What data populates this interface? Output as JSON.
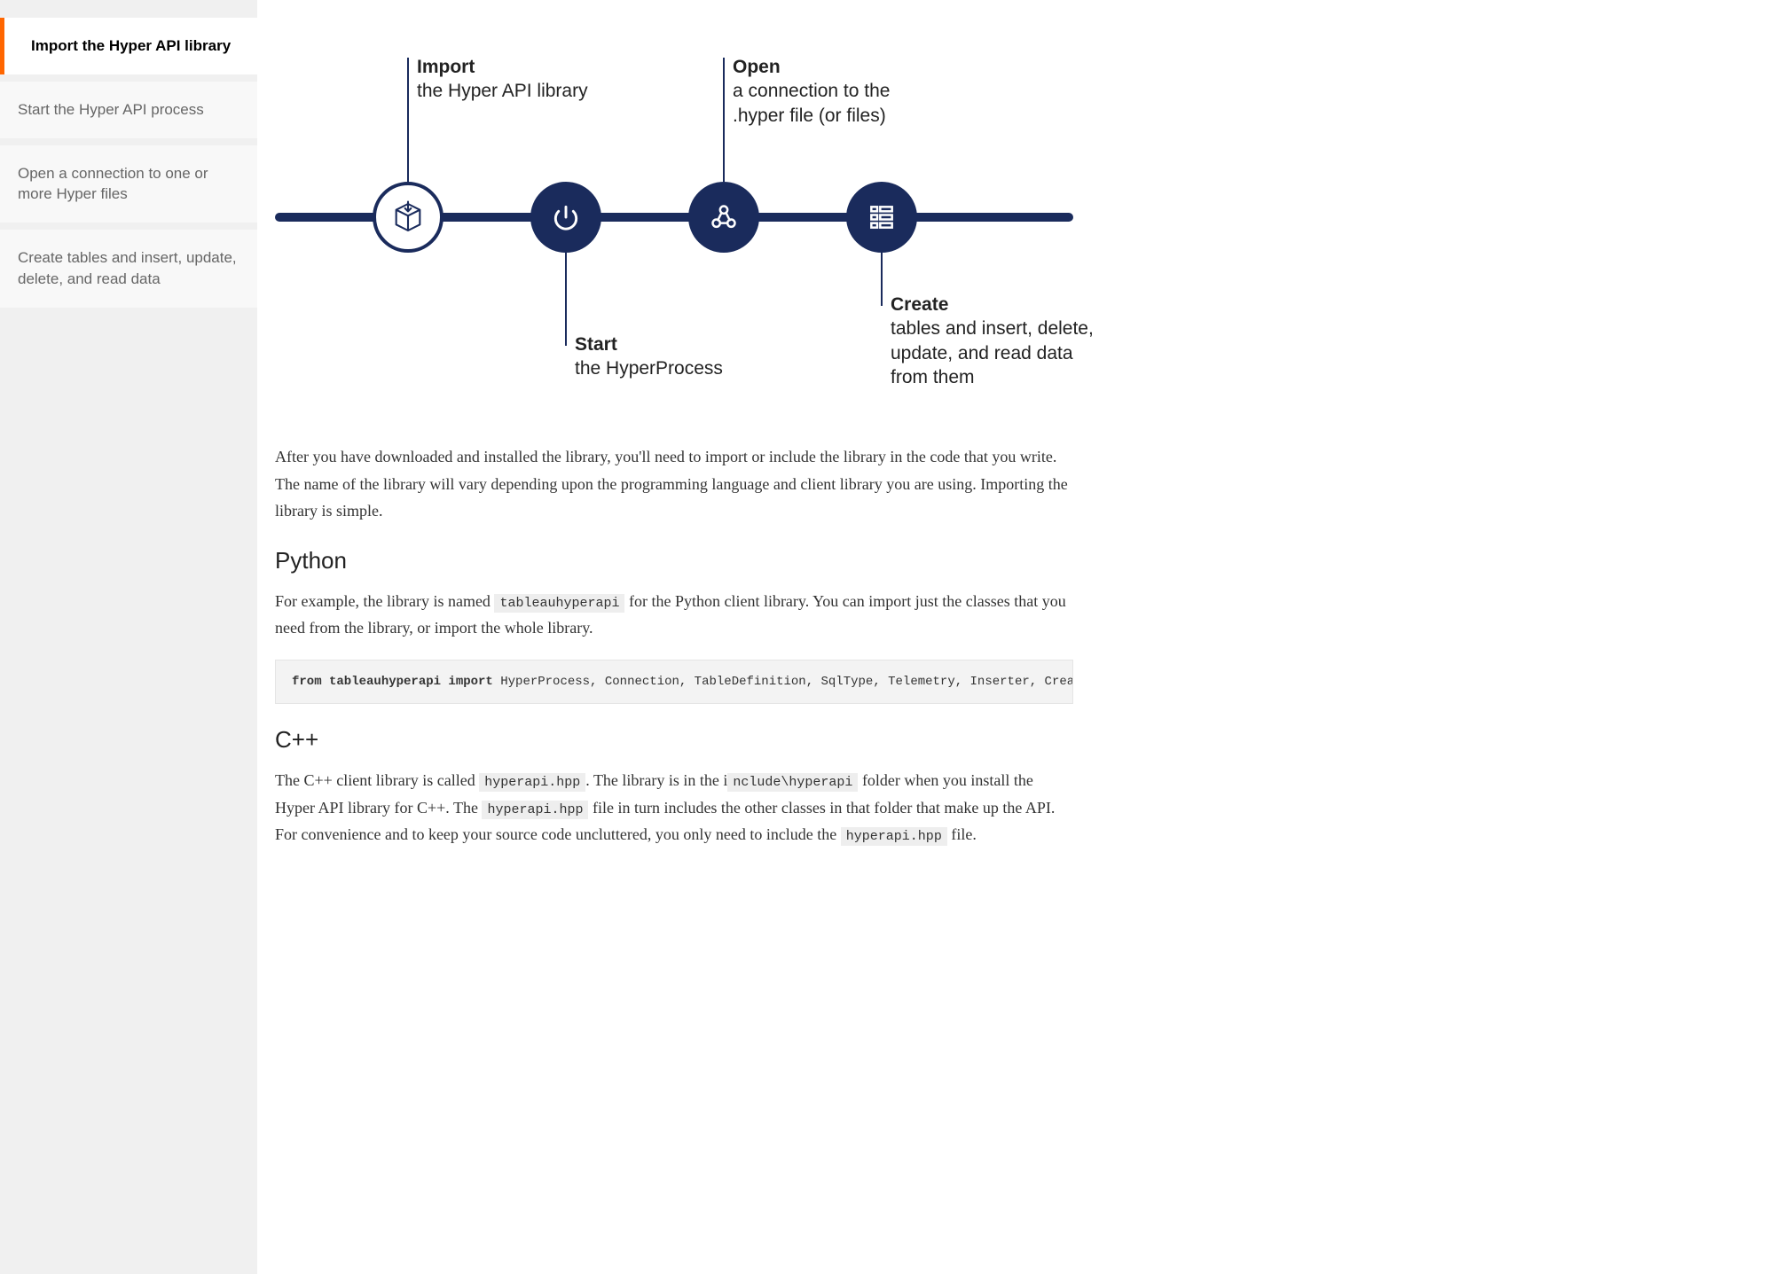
{
  "sidebar": {
    "items": [
      "Import the Hyper API library",
      "Start the Hyper API process",
      "Open a connection to one or more Hyper files",
      "Create tables and insert, update, delete, and read data"
    ]
  },
  "diagram": {
    "import": {
      "title": "Import",
      "sub": "the Hyper API library"
    },
    "start": {
      "title": "Start",
      "sub": "the HyperProcess"
    },
    "open": {
      "title": "Open",
      "sub": "a connection to the .hyper file (or files)"
    },
    "create": {
      "title": "Create",
      "sub": "tables and insert, delete, update, and read data from them"
    }
  },
  "content": {
    "intro": "After you have downloaded and installed the library, you'll need to import or include the library in the code that you write. The name of the library will vary depending upon the programming language and client library you are using. Importing the library is simple.",
    "python_h": "Python",
    "python_p1a": "For example, the library is named ",
    "python_code1": "tableauhyperapi",
    "python_p1b": " for the Python client library. You can import just the classes that you need from the library, or import the whole library.",
    "python_block_kw": "from tableauhyperapi import",
    "python_block_rest": " HyperProcess, Connection, TableDefinition, SqlType, Telemetry, Inserter, CreateMode",
    "cpp_h": "C++",
    "cpp_p1a": "The C++ client library is called ",
    "cpp_code1": "hyperapi.hpp",
    "cpp_p1b": ". The library is in the i",
    "cpp_code2": "nclude\\hyperapi",
    "cpp_p1c": " folder when you install the Hyper API library for C++. The ",
    "cpp_code3": "hyperapi.hpp",
    "cpp_p1d": " file in turn includes the other classes in that folder that make up the API. For convenience and to keep your source code uncluttered, you only need to include the ",
    "cpp_code4": "hyperapi.hpp",
    "cpp_p1e": " file."
  }
}
